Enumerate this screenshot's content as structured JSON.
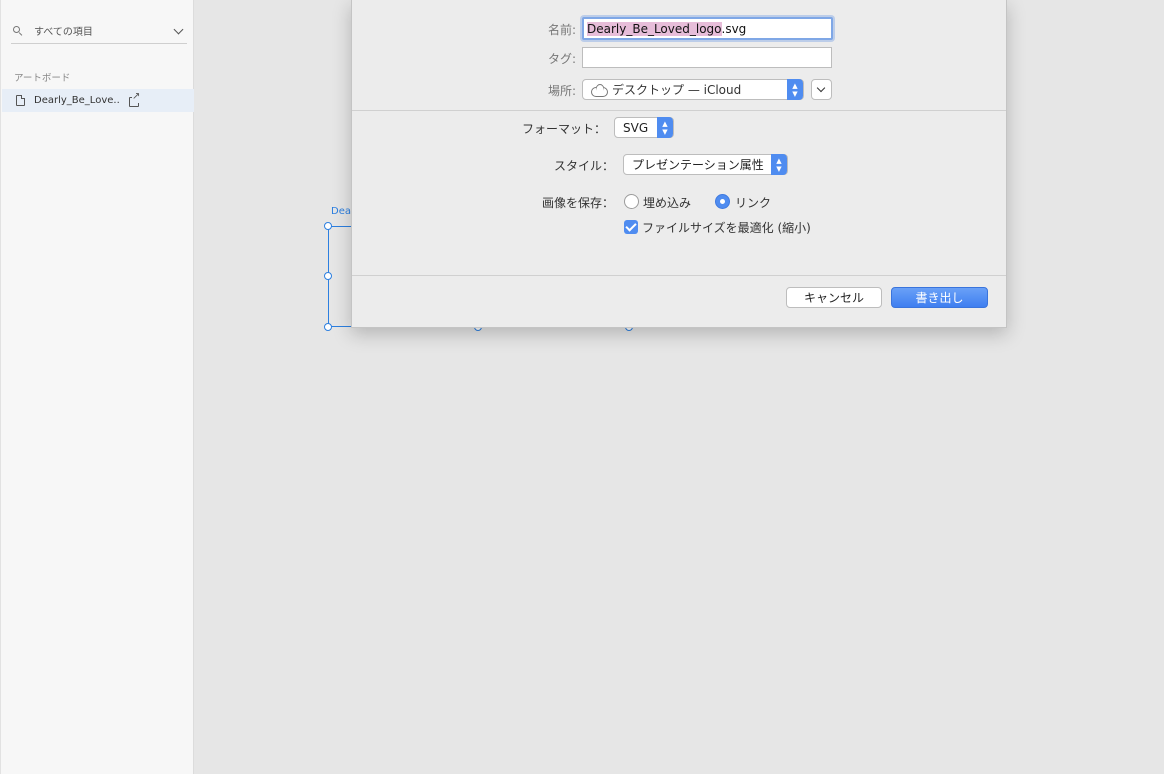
{
  "sidebar": {
    "filter_label": "すべての項目",
    "section_title": "アートボード",
    "artboards": [
      {
        "label": "Dearly_Be_Love..."
      }
    ]
  },
  "canvas": {
    "artboard_label": "Dea"
  },
  "dialog": {
    "name_label": "名前:",
    "name_value_selected": "Dearly_Be_Loved_logo",
    "name_value_ext": ".svg",
    "tags_label": "タグ:",
    "location_label": "場所:",
    "location_value": "デスクトップ — iCloud",
    "format_label": "フォーマット：",
    "format_value": "SVG",
    "style_label": "スタイル：",
    "style_value": "プレゼンテーション属性",
    "save_images_label": "画像を保存：",
    "embed_label": "埋め込み",
    "link_label": "リンク",
    "selected_image_option": "リンク",
    "optimize_label": "ファイルサイズを最適化 (縮小)",
    "optimize_checked": true,
    "cancel_label": "キャンセル",
    "export_label": "書き出し"
  },
  "colors": {
    "accent": "#4f8cf0",
    "selection_highlight": "#e7bdd9",
    "artboard_blue": "#2c7fe0"
  }
}
